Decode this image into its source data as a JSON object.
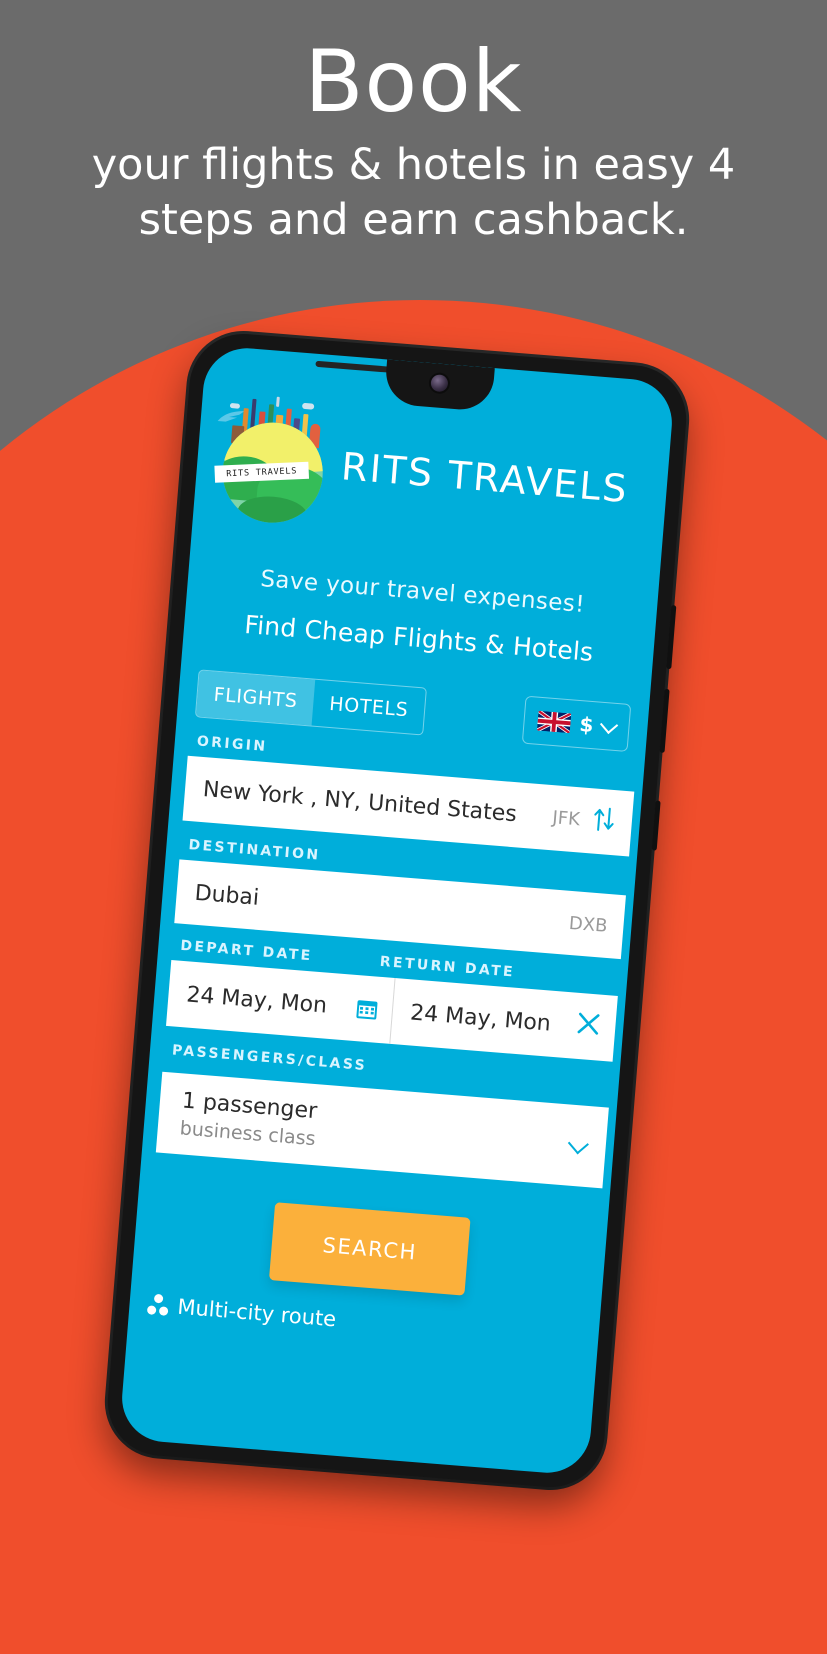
{
  "poster": {
    "headline": "Book",
    "subheadline": "your flights & hotels in easy 4 steps and earn cashback.",
    "bg_color": "#6b6b6b",
    "accent_color": "#f04e2c"
  },
  "app": {
    "brand_name": "RITS TRAVELS",
    "logo_band_text": "RITS TRAVELS",
    "tagline_primary": "Save your travel expenses!",
    "tagline_secondary": "Find Cheap Flights & Hotels",
    "theme_color": "#00AEDA",
    "button_color": "#FBB03B",
    "tabs": [
      {
        "label": "FLIGHTS",
        "active": true
      },
      {
        "label": "HOTELS",
        "active": false
      }
    ],
    "currency": {
      "flag": "uk-flag-icon",
      "symbol": "$",
      "chevron": "chevron-down-icon"
    },
    "form": {
      "origin": {
        "label": "ORIGIN",
        "value": "New York , NY, United States",
        "code": "JFK",
        "swap_icon": "swap-vertical-icon"
      },
      "destination": {
        "label": "DESTINATION",
        "value": "Dubai",
        "code": "DXB"
      },
      "depart": {
        "label": "DEPART DATE",
        "value": "24 May, Mon",
        "icon": "calendar-icon"
      },
      "return": {
        "label": "RETURN DATE",
        "value": "24 May, Mon",
        "icon": "close-icon"
      },
      "passengers": {
        "label": "PASSENGERS/CLASS",
        "count_text": "1 passenger",
        "class_text": "business class",
        "chevron": "chevron-down-icon"
      }
    },
    "search_label": "SEARCH",
    "multicity_label": "Multi-city route",
    "multicity_icon": "multi-city-icon"
  }
}
